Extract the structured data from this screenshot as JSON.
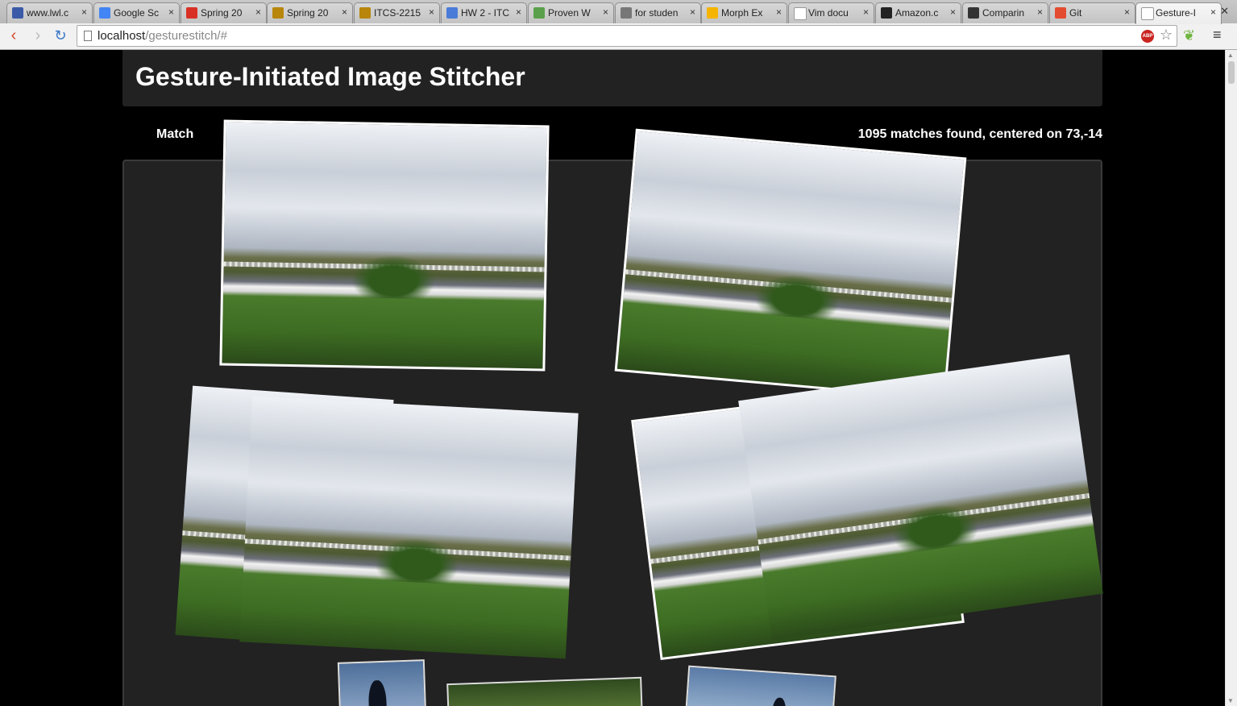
{
  "browser": {
    "tabs": [
      {
        "title": "www.lwl.c",
        "favicon": "lwl-icon",
        "color": "#3a5aa8"
      },
      {
        "title": "Google Sc",
        "favicon": "google-icon",
        "color": "#4285f4"
      },
      {
        "title": "Spring 20",
        "favicon": "gmail-icon",
        "color": "#d93025"
      },
      {
        "title": "Spring 20",
        "favicon": "university-icon",
        "color": "#b8860b"
      },
      {
        "title": "ITCS-2215",
        "favicon": "university-icon",
        "color": "#b8860b"
      },
      {
        "title": "HW 2 - ITC",
        "favicon": "docs-icon",
        "color": "#4a7bd9"
      },
      {
        "title": "Proven W",
        "favicon": "leaf-icon",
        "color": "#5aa04a"
      },
      {
        "title": "for studen",
        "favicon": "folder-icon",
        "color": "#777777"
      },
      {
        "title": "Morph Ex",
        "favicon": "slides-icon",
        "color": "#f4b400"
      },
      {
        "title": "Vim docu",
        "favicon": "page-icon",
        "color": "#ffffff"
      },
      {
        "title": "Amazon.c",
        "favicon": "amazon-icon",
        "color": "#222222"
      },
      {
        "title": "Comparin",
        "favicon": "github-icon",
        "color": "#333333"
      },
      {
        "title": "Git",
        "favicon": "git-icon",
        "color": "#e44c30"
      },
      {
        "title": "Gesture-I",
        "favicon": "page-icon",
        "color": "#ffffff",
        "active": true
      }
    ],
    "url_host": "localhost",
    "url_path": "/gesturestitch/#"
  },
  "page": {
    "title": "Gesture-Initiated Image Stitcher",
    "match_label": "Match",
    "status": "1095 matches found, centered on 73,-14"
  }
}
